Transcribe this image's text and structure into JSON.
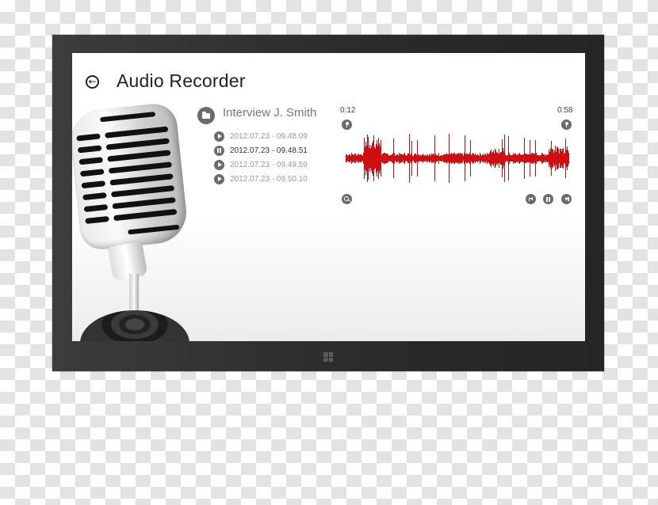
{
  "app": {
    "title": "Audio Recorder",
    "back_icon": "back-arrow-circle-icon"
  },
  "recording_group": {
    "icon": "folder-icon",
    "title": "Interview J. Smith",
    "items": [
      {
        "label": "2012.07.23 - 09.48.09",
        "state": "play",
        "icon": "play-icon"
      },
      {
        "label": "2012.07.23 - 09.48.51",
        "state": "pause",
        "icon": "pause-icon",
        "active": true
      },
      {
        "label": "2012.07.23 - 09.49.59",
        "state": "play",
        "icon": "play-icon"
      },
      {
        "label": "2012.07.23 - 09.50.10",
        "state": "play",
        "icon": "play-icon"
      }
    ]
  },
  "player": {
    "start_time": "0:12",
    "end_time": "0:58",
    "start_marker_icon": "location-pin-icon",
    "end_marker_icon": "location-pin-icon",
    "waveform_color": "#d10d12",
    "controls": {
      "zoom_icon": "magnifier-icon",
      "previous_icon": "skip-previous-icon",
      "pause_icon": "pause-icon",
      "next_icon": "skip-next-icon"
    }
  },
  "device": {
    "windows_button_icon": "windows-logo-icon"
  }
}
